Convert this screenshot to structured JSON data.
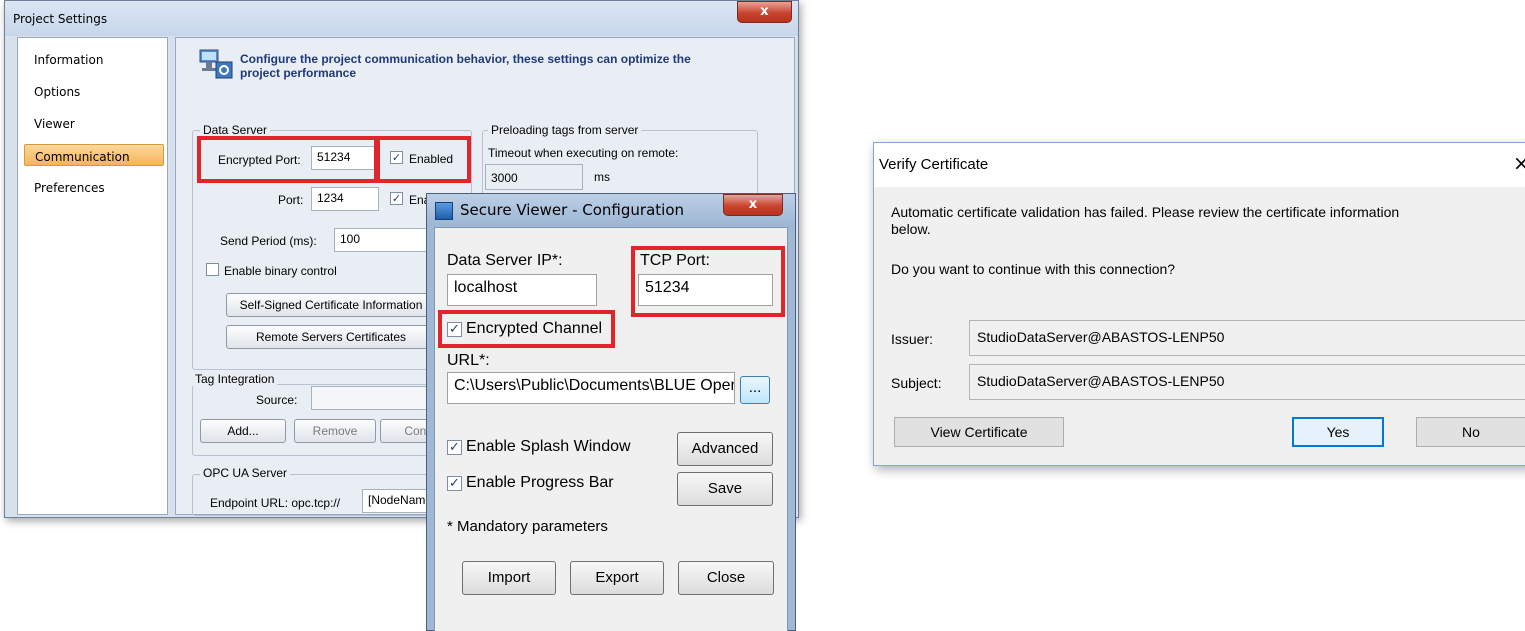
{
  "project_settings": {
    "title": "Project Settings",
    "close_glyph": "x",
    "nav": [
      "Information",
      "Options",
      "Viewer",
      "Communication",
      "Preferences"
    ],
    "header_text_line1": "Configure the project communication behavior, these settings can optimize the",
    "header_text_line2": "project performance",
    "header_icon": "network-settings-icon",
    "data_server": {
      "group_label": "Data Server",
      "encrypted_port_label": "Encrypted Port:",
      "encrypted_port_value": "51234",
      "encrypted_enabled_label": "Enabled",
      "port_label": "Port:",
      "port_value": "1234",
      "port_enabled_label": "Enabled",
      "send_period_label": "Send Period (ms):",
      "send_period_value": "100",
      "binary_control_label": "Enable binary control",
      "self_signed_button": "Self-Signed Certificate Information",
      "remote_certs_button": "Remote Servers Certificates"
    },
    "preloading": {
      "group_label": "Preloading tags from server",
      "timeout_label": "Timeout when executing on remote:",
      "timeout_value": "3000",
      "timeout_unit": "ms"
    },
    "tag_integration": {
      "group_label": "Tag Integration",
      "source_label": "Source:",
      "add_button": "Add...",
      "remove_button": "Remove",
      "configure_button": "Configu"
    },
    "opc_ua": {
      "group_label": "OPC UA Server",
      "endpoint_label": "Endpoint URL: opc.tcp://",
      "endpoint_value": "[NodeName"
    }
  },
  "secure_viewer": {
    "title": "Secure Viewer - Configuration",
    "close_glyph": "x",
    "ip_label": "Data Server IP*:",
    "ip_value": "localhost",
    "tcp_port_label": "TCP Port:",
    "tcp_port_value": "51234",
    "encrypted_channel_label": "Encrypted Channel",
    "url_label": "URL*:",
    "url_value": "C:\\Users\\Public\\Documents\\BLUE Open",
    "browse_button": "...",
    "splash_label": "Enable Splash Window",
    "progress_label": "Enable Progress Bar",
    "advanced_button": "Advanced",
    "save_button": "Save",
    "mandatory_note": "* Mandatory parameters",
    "import_button": "Import",
    "export_button": "Export",
    "close_button": "Close"
  },
  "verify_certificate": {
    "title": "Verify Certificate",
    "close_glyph": "×",
    "message_line1": "Automatic certificate validation has failed. Please review the certificate information",
    "message_line2": "below.",
    "question": "Do you want to continue with this connection?",
    "issuer_label": "Issuer:",
    "issuer_value": "StudioDataServer@ABASTOS-LENP50",
    "subject_label": "Subject:",
    "subject_value": "StudioDataServer@ABASTOS-LENP50",
    "view_certificate_button": "View Certificate",
    "yes_button": "Yes",
    "no_button": "No"
  },
  "colors": {
    "highlight": "#e0262c",
    "nav_selected": "#f6b35a",
    "header_text": "#1f3a7a"
  }
}
